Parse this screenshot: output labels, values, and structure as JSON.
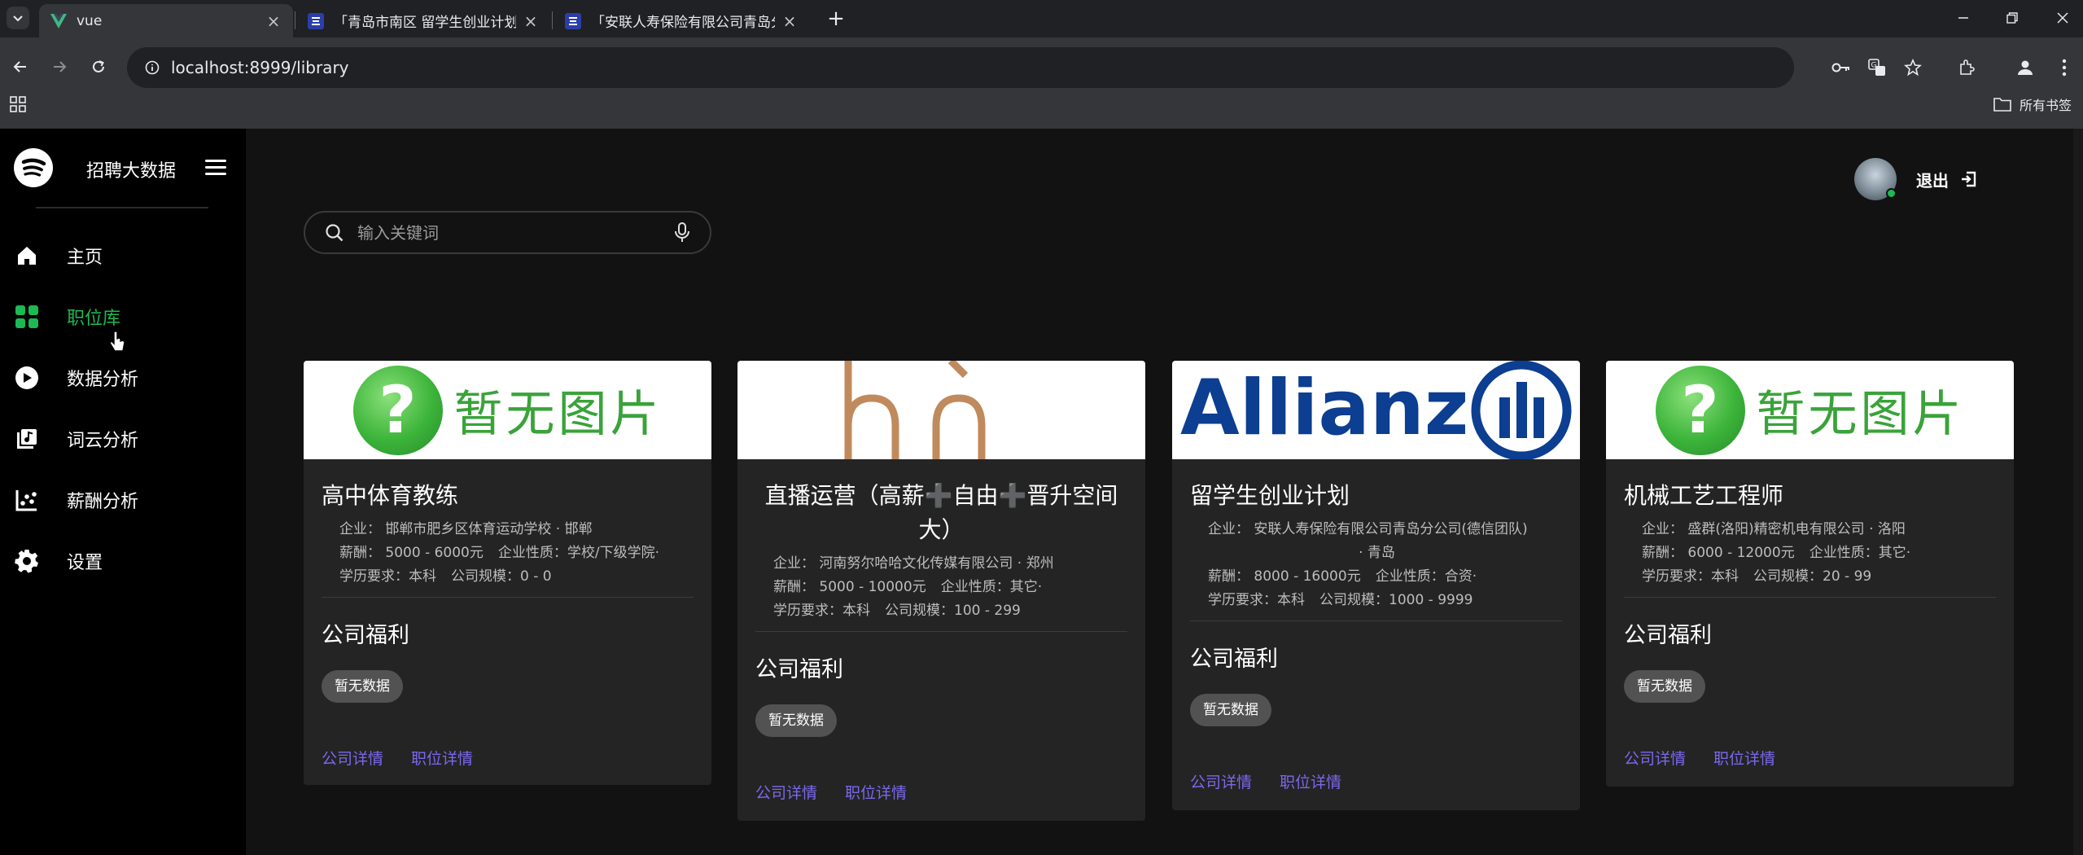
{
  "browser": {
    "tabs": [
      {
        "title": "vue",
        "active": true
      },
      {
        "title": "「青岛市南区 留学生创业计划」",
        "active": false
      },
      {
        "title": "「安联人寿保险有限公司青岛分",
        "active": false
      }
    ],
    "url": "localhost:8999/library",
    "all_bookmarks": "所有书签"
  },
  "sidebar": {
    "brand": "招聘大数据",
    "items": [
      {
        "label": "主页",
        "icon": "home-icon",
        "active": false
      },
      {
        "label": "职位库",
        "icon": "grid-icon",
        "active": true
      },
      {
        "label": "数据分析",
        "icon": "play-circle-icon",
        "active": false
      },
      {
        "label": "词云分析",
        "icon": "library-music-icon",
        "active": false
      },
      {
        "label": "薪酬分析",
        "icon": "scatter-chart-icon",
        "active": false
      },
      {
        "label": "设置",
        "icon": "gear-icon",
        "active": false
      }
    ]
  },
  "header": {
    "logout": "退出"
  },
  "search": {
    "placeholder": "输入关键词"
  },
  "colors": {
    "accent": "#1db954",
    "link": "#7b68ee",
    "card_bg": "#242424",
    "main_bg": "#121212"
  },
  "cards": [
    {
      "image": "no-image",
      "image_text": "暂无图片",
      "title": "高中体育教练",
      "company_line": "企业：  邯郸市肥乡区体育运动学校 · 邯郸",
      "salary_line": "薪酬：  5000 - 6000元",
      "nature_line": "企业性质：学校/下级学院·",
      "edu_line": "学历要求：本科",
      "scale_line": "公司规模：0 - 0",
      "welfare_title": "公司福利",
      "welfare_chip": "暂无数据",
      "link_company": "公司详情",
      "link_job": "职位详情"
    },
    {
      "image": "brand-logo",
      "title": "直播运营（高薪➕自由➕晋升空间大）",
      "company_line": "企业：  河南努尔哈哈文化传媒有限公司 · 郑州",
      "salary_line": "薪酬：  5000 - 10000元",
      "nature_line": "企业性质：其它·",
      "edu_line": "学历要求：本科",
      "scale_line": "公司规模：100 - 299",
      "welfare_title": "公司福利",
      "welfare_chip": "暂无数据",
      "link_company": "公司详情",
      "link_job": "职位详情"
    },
    {
      "image": "allianz-logo",
      "image_text": "Allianz",
      "title": "留学生创业计划",
      "company_line": "企业：  安联人寿保险有限公司青岛分公司(德信团队)",
      "company_line2": "· 青岛",
      "salary_line": "薪酬：  8000 - 16000元",
      "nature_line": "企业性质：合资·",
      "edu_line": "学历要求：本科",
      "scale_line": "公司规模：1000 - 9999",
      "welfare_title": "公司福利",
      "welfare_chip": "暂无数据",
      "link_company": "公司详情",
      "link_job": "职位详情"
    },
    {
      "image": "no-image",
      "image_text": "暂无图片",
      "title": "机械工艺工程师",
      "company_line": "企业：  盛群(洛阳)精密机电有限公司 · 洛阳",
      "salary_line": "薪酬：  6000 - 12000元",
      "nature_line": "企业性质：其它·",
      "edu_line": "学历要求：本科",
      "scale_line": "公司规模：20 - 99",
      "welfare_title": "公司福利",
      "welfare_chip": "暂无数据",
      "link_company": "公司详情",
      "link_job": "职位详情"
    }
  ]
}
